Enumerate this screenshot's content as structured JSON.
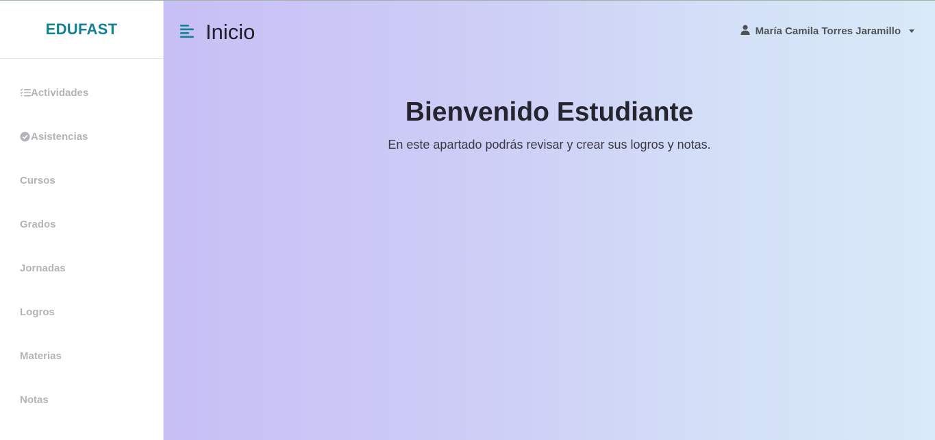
{
  "sidebar": {
    "brand": "EDUFAST",
    "items": [
      {
        "label": "Actividades",
        "icon": "checklist-icon"
      },
      {
        "label": "Asistencias",
        "icon": "check-circle-icon"
      },
      {
        "label": "Cursos",
        "icon": ""
      },
      {
        "label": "Grados",
        "icon": ""
      },
      {
        "label": "Jornadas",
        "icon": ""
      },
      {
        "label": "Logros",
        "icon": ""
      },
      {
        "label": "Materias",
        "icon": ""
      },
      {
        "label": "Notas",
        "icon": ""
      }
    ]
  },
  "header": {
    "title": "Inicio",
    "menu_icon": "menu-icon",
    "user_name": "María Camila Torres Jaramillo",
    "user_icon": "user-icon"
  },
  "main": {
    "heading": "Bienvenido Estudiante",
    "subtitle": "En este apartado podrás revisar y crear sus logros y notas."
  },
  "colors": {
    "brand": "#128394",
    "sidebar_text": "#b4b4b8",
    "gradient_start": "#c7bff5",
    "gradient_end": "#d9eaf8"
  }
}
